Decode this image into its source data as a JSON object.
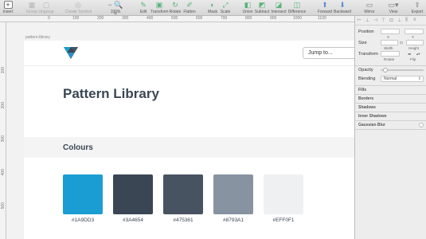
{
  "toolbar": {
    "items": [
      {
        "label": "Insert",
        "icon": "insert-icon"
      },
      {
        "label": "Group",
        "icon": "group-icon"
      },
      {
        "label": "Ungroup",
        "icon": "ungroup-icon"
      },
      {
        "label": "Create Symbol",
        "icon": "symbol-icon"
      },
      {
        "label": "100%",
        "icon": "zoom-icon"
      },
      {
        "label": "Edit",
        "icon": "edit-icon"
      },
      {
        "label": "Transform",
        "icon": "transform-icon"
      },
      {
        "label": "Rotate",
        "icon": "rotate-icon"
      },
      {
        "label": "Flatten",
        "icon": "flatten-icon"
      },
      {
        "label": "Mask",
        "icon": "mask-icon"
      },
      {
        "label": "Scale",
        "icon": "scale-icon"
      },
      {
        "label": "Union",
        "icon": "union-icon"
      },
      {
        "label": "Subtract",
        "icon": "subtract-icon"
      },
      {
        "label": "Intersect",
        "icon": "intersect-icon"
      },
      {
        "label": "Difference",
        "icon": "difference-icon"
      },
      {
        "label": "Forward",
        "icon": "forward-icon"
      },
      {
        "label": "Backward",
        "icon": "backward-icon"
      },
      {
        "label": "Mirror",
        "icon": "mirror-icon"
      },
      {
        "label": "View",
        "icon": "view-icon"
      },
      {
        "label": "Export",
        "icon": "export-icon"
      }
    ]
  },
  "ruler": {
    "top_ticks": [
      "0",
      "100",
      "200",
      "300",
      "400",
      "500",
      "600",
      "700",
      "800",
      "900",
      "1000",
      "1100"
    ],
    "left_ticks": [
      "100",
      "200",
      "300",
      "400",
      "500"
    ]
  },
  "canvas": {
    "artboard_name": "pattern-library",
    "jump_placeholder": "Jump to...",
    "title": "Pattern Library",
    "section_title": "Colours",
    "swatches": [
      {
        "hex": "#1A9DD3"
      },
      {
        "hex": "#3A4654"
      },
      {
        "hex": "#475361"
      },
      {
        "hex": "#8793A1"
      },
      {
        "hex": "#EFF0F1"
      }
    ]
  },
  "inspector": {
    "position_label": "Position",
    "x_label": "X",
    "y_label": "Y",
    "size_label": "Size",
    "width_label": "Width",
    "height_label": "Height",
    "transform_label": "Transform",
    "rotate_label": "Rotate",
    "flip_label": "Flip",
    "opacity_label": "Opacity",
    "blending_label": "Blending",
    "blending_value": "Normal",
    "fills_label": "Fills",
    "borders_label": "Borders",
    "shadows_label": "Shadows",
    "inner_shadows_label": "Inner Shadows",
    "gaussian_blur_label": "Gaussian Blur"
  }
}
